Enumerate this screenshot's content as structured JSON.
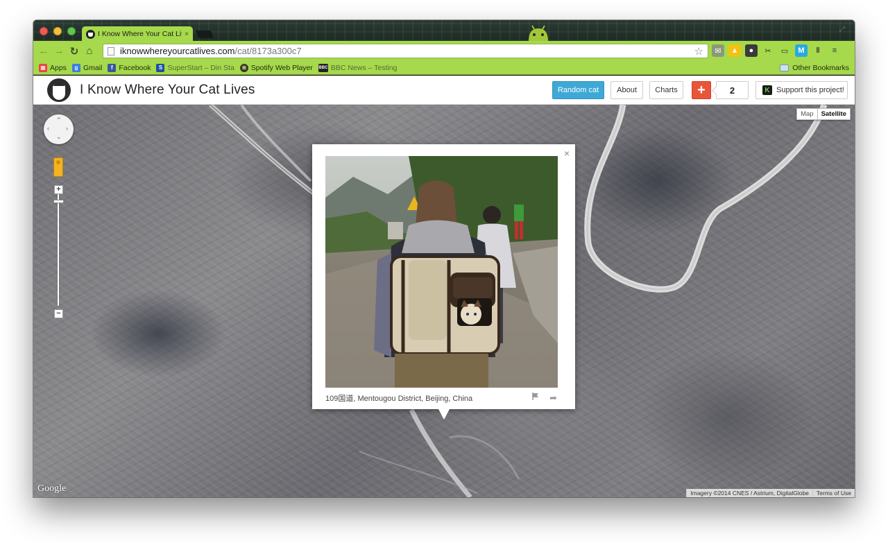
{
  "browser": {
    "tab": {
      "title": "I Know Where Your Cat Lives",
      "close": "×"
    },
    "url": {
      "host": "iknowwhereyourcatlives.com",
      "path": "/cat/8173a300c7"
    },
    "bookmarks": [
      {
        "label": "Apps",
        "icon": "apps-grid-icon",
        "color": "#e44"
      },
      {
        "label": "Gmail",
        "icon": "google-icon",
        "color": "#3b7de3"
      },
      {
        "label": "Facebook",
        "icon": "facebook-icon",
        "color": "#3b5998"
      },
      {
        "label": "SuperStart – Din Sta",
        "icon": "superstart-icon",
        "color": "#1f4fa0"
      },
      {
        "label": "Spotify Web Player",
        "icon": "spotify-icon",
        "color": "#3a3a1a"
      },
      {
        "label": "BBC News – Testing",
        "icon": "bbc-icon",
        "color": "#222"
      }
    ],
    "other_bookmarks": "Other Bookmarks"
  },
  "site": {
    "title": "I Know Where Your Cat Lives",
    "buttons": {
      "random": "Random cat",
      "about": "About",
      "charts": "Charts",
      "plus": "+",
      "count": "2",
      "support": "Support this project!"
    }
  },
  "map": {
    "type_map": "Map",
    "type_satellite": "Satellite",
    "google": "Google",
    "imagery": "Imagery ©2014 CNES / Astrium, DigitalGlobe",
    "terms": "Terms of Use",
    "zoom_in": "+",
    "zoom_out": "−"
  },
  "popup": {
    "caption": "109国道, Mentougou District, Beijing, China",
    "close": "×"
  },
  "colors": {
    "chrome_green": "#a6d94b",
    "random_button": "#3fa9d6",
    "plus_button": "#e8553a"
  }
}
